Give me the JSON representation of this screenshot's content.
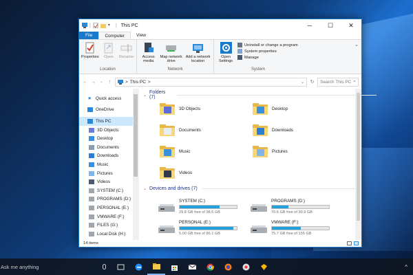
{
  "taskbar": {
    "search_placeholder": "Ask me anything",
    "apps": [
      "task-view-icon",
      "edge-icon",
      "file-explorer-icon",
      "store-icon",
      "mail-icon",
      "chrome-icon",
      "firefox-icon",
      "media-icon",
      "sketch-icon"
    ],
    "tray_chevron": "^"
  },
  "window": {
    "title": "This PC",
    "tabs": [
      "File",
      "Computer",
      "View"
    ],
    "active_tab": "Computer",
    "ribbon": {
      "location": {
        "label": "Location",
        "buttons": [
          "Properties",
          "Open",
          "Rename"
        ]
      },
      "network": {
        "label": "Network",
        "buttons": [
          "Access media",
          "Map network drive",
          "Add a network location"
        ]
      },
      "system": {
        "label": "System",
        "open_settings": "Open Settings",
        "items": [
          "Uninstall or change a program",
          "System properties",
          "Manage"
        ]
      }
    },
    "address": {
      "path": "This PC",
      "separator": ">",
      "search_placeholder": "Search This PC"
    },
    "nav": [
      {
        "label": "Quick access",
        "icon": "star-icon"
      },
      {
        "label": "OneDrive",
        "icon": "cloud-icon"
      },
      {
        "label": "This PC",
        "icon": "computer-icon",
        "selected": true
      },
      {
        "label": "3D Objects",
        "icon": "cube-icon"
      },
      {
        "label": "Desktop",
        "icon": "desktop-icon"
      },
      {
        "label": "Documents",
        "icon": "documents-icon"
      },
      {
        "label": "Downloads",
        "icon": "download-icon"
      },
      {
        "label": "Music",
        "icon": "music-icon"
      },
      {
        "label": "Pictures",
        "icon": "pictures-icon"
      },
      {
        "label": "Videos",
        "icon": "videos-icon"
      },
      {
        "label": "SYSTEM (C:)",
        "icon": "drive-icon"
      },
      {
        "label": "PROGRAMS (D:)",
        "icon": "drive-icon"
      },
      {
        "label": "PERSONAL (E:)",
        "icon": "drive-icon"
      },
      {
        "label": "VMWARE (F:)",
        "icon": "drive-icon"
      },
      {
        "label": "FILES (G:)",
        "icon": "drive-icon"
      },
      {
        "label": "Local Disk (H:)",
        "icon": "drive-icon"
      }
    ],
    "folders_header": "Folders (7)",
    "folders": [
      {
        "label": "3D Objects",
        "emblem": "#5b6fd6"
      },
      {
        "label": "Desktop",
        "emblem": "#3b8fe0"
      },
      {
        "label": "Documents",
        "emblem": "#e9eef5"
      },
      {
        "label": "Downloads",
        "emblem": "#2a7fd4"
      },
      {
        "label": "Music",
        "emblem": "#3b8fe0"
      },
      {
        "label": "Pictures",
        "emblem": "#7fb5e8"
      },
      {
        "label": "Videos",
        "emblem": "#2f3a48"
      }
    ],
    "drives_header": "Devices and drives (7)",
    "drives": [
      {
        "label": "SYSTEM (C:)",
        "free": "29.8 GB free of 98.6 GB",
        "used": 0.7
      },
      {
        "label": "PROGRAMS (D:)",
        "free": "70.6 GB free of 99.9 GB",
        "used": 0.29
      },
      {
        "label": "PERSONAL (E:)",
        "free": "5.00 GB free of 86.1 GB",
        "used": 0.94
      },
      {
        "label": "VMWARE (F:)",
        "free": "75.7 GB free of 155 GB",
        "used": 0.51
      }
    ],
    "status": "14 items"
  }
}
